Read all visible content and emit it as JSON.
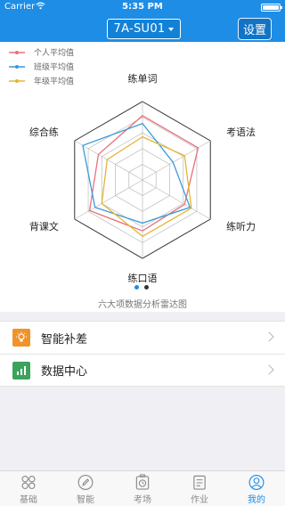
{
  "status_bar": {
    "carrier": "Carrier",
    "time": "5:35 PM"
  },
  "header": {
    "class_selector": "7A-SU01",
    "settings_label": "设置"
  },
  "colors": {
    "header_blue": "#1e8de6",
    "personal": "#e8707a",
    "class": "#3a9ad9",
    "grade": "#e5b534"
  },
  "chart_data": {
    "type": "radar",
    "title": "六大项数据分析雷达图",
    "axes": [
      "练单词",
      "考语法",
      "练听力",
      "练口语",
      "背课文",
      "综合练"
    ],
    "max": 100,
    "legend_position": "top-left",
    "series": [
      {
        "name": "个人平均值",
        "color": "#e8707a",
        "values": [
          82,
          82,
          62,
          65,
          78,
          65
        ]
      },
      {
        "name": "班级平均值",
        "color": "#3a9ad9",
        "values": [
          72,
          45,
          70,
          55,
          70,
          88
        ]
      },
      {
        "name": "年级平均值",
        "color": "#e5b534",
        "values": [
          55,
          62,
          72,
          72,
          60,
          52
        ]
      }
    ]
  },
  "pager": {
    "pages": 2,
    "current": 1
  },
  "menu": [
    {
      "label": "智能补差",
      "icon": "bulb-icon",
      "icon_color": "#f0932b"
    },
    {
      "label": "数据中心",
      "icon": "bar-chart-icon",
      "icon_color": "#3aa35c"
    }
  ],
  "tabbar": [
    {
      "label": "基础",
      "icon": "grid-icon",
      "active": false
    },
    {
      "label": "智能",
      "icon": "pencil-icon",
      "active": false
    },
    {
      "label": "考场",
      "icon": "timer-icon",
      "active": false
    },
    {
      "label": "作业",
      "icon": "clipboard-icon",
      "active": false
    },
    {
      "label": "我的",
      "icon": "user-icon",
      "active": true
    }
  ]
}
